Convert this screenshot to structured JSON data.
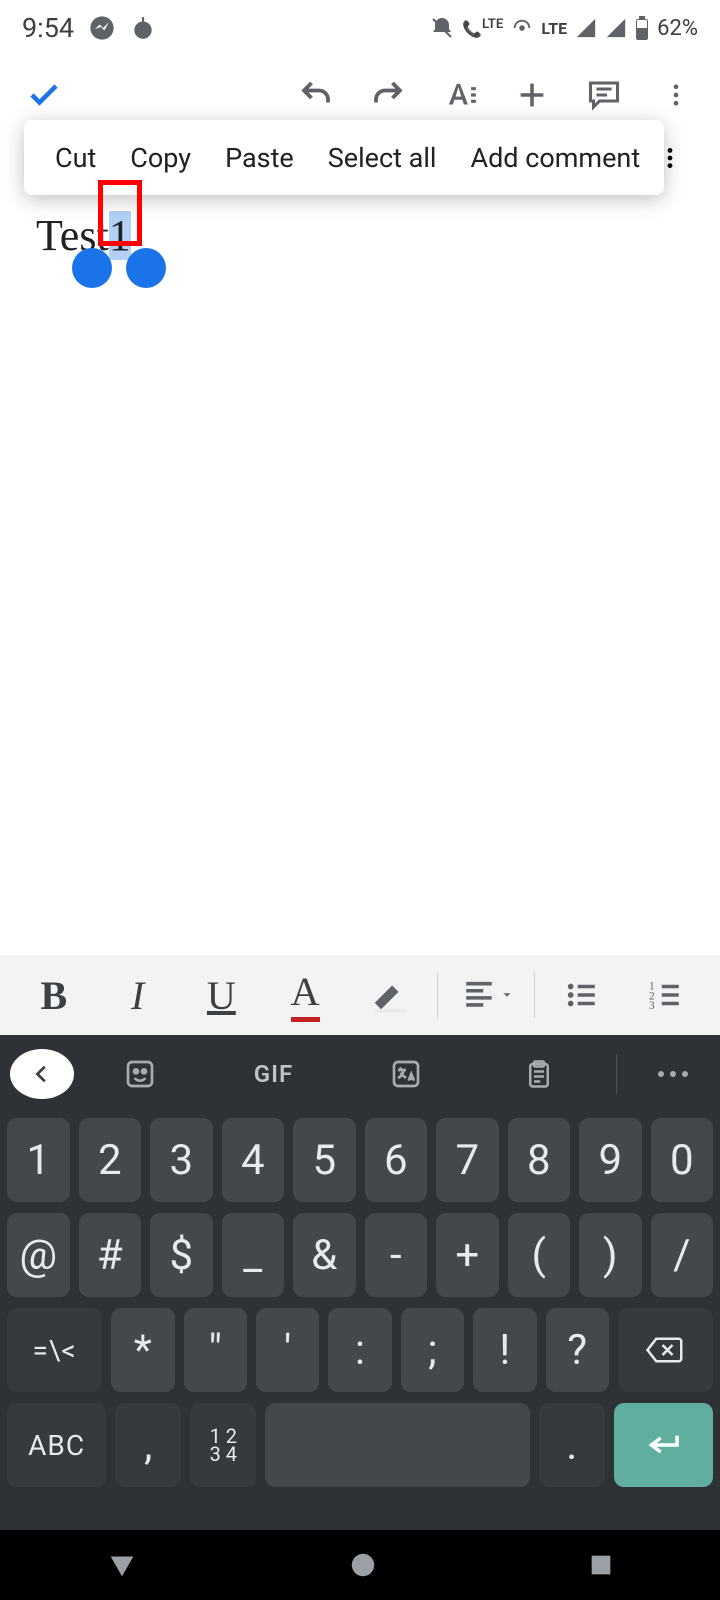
{
  "statusbar": {
    "time": "9:54",
    "battery": "62%",
    "net": "LTE"
  },
  "appbar": {
    "icons": [
      "confirm",
      "undo",
      "redo",
      "textformat",
      "insert",
      "comment",
      "more"
    ]
  },
  "context_menu": {
    "items": [
      "Cut",
      "Copy",
      "Paste",
      "Select all",
      "Add comment"
    ]
  },
  "document": {
    "text_before": "Tes",
    "text_middle": "t",
    "text_selected": "1"
  },
  "format_bar": {
    "bold": "B",
    "italic": "I",
    "underline": "U",
    "textcolor": "A",
    "highlight": "✎",
    "align": "≡",
    "bullets": "⋮≡",
    "numbered": "123"
  },
  "keyboard": {
    "suggestions": {
      "gif": "GIF"
    },
    "row1": [
      "1",
      "2",
      "3",
      "4",
      "5",
      "6",
      "7",
      "8",
      "9",
      "0"
    ],
    "row2": [
      "@",
      "#",
      "$",
      "_",
      "&",
      "-",
      "+",
      "(",
      ")",
      "/"
    ],
    "row3": {
      "shift": "=\\<",
      "keys": [
        "*",
        "\"",
        "'",
        ":",
        ";",
        "!",
        "?"
      ]
    },
    "row4": {
      "abc": "ABC",
      "comma": ",",
      "num": [
        "1 2",
        "3 4"
      ],
      "period": "."
    }
  }
}
